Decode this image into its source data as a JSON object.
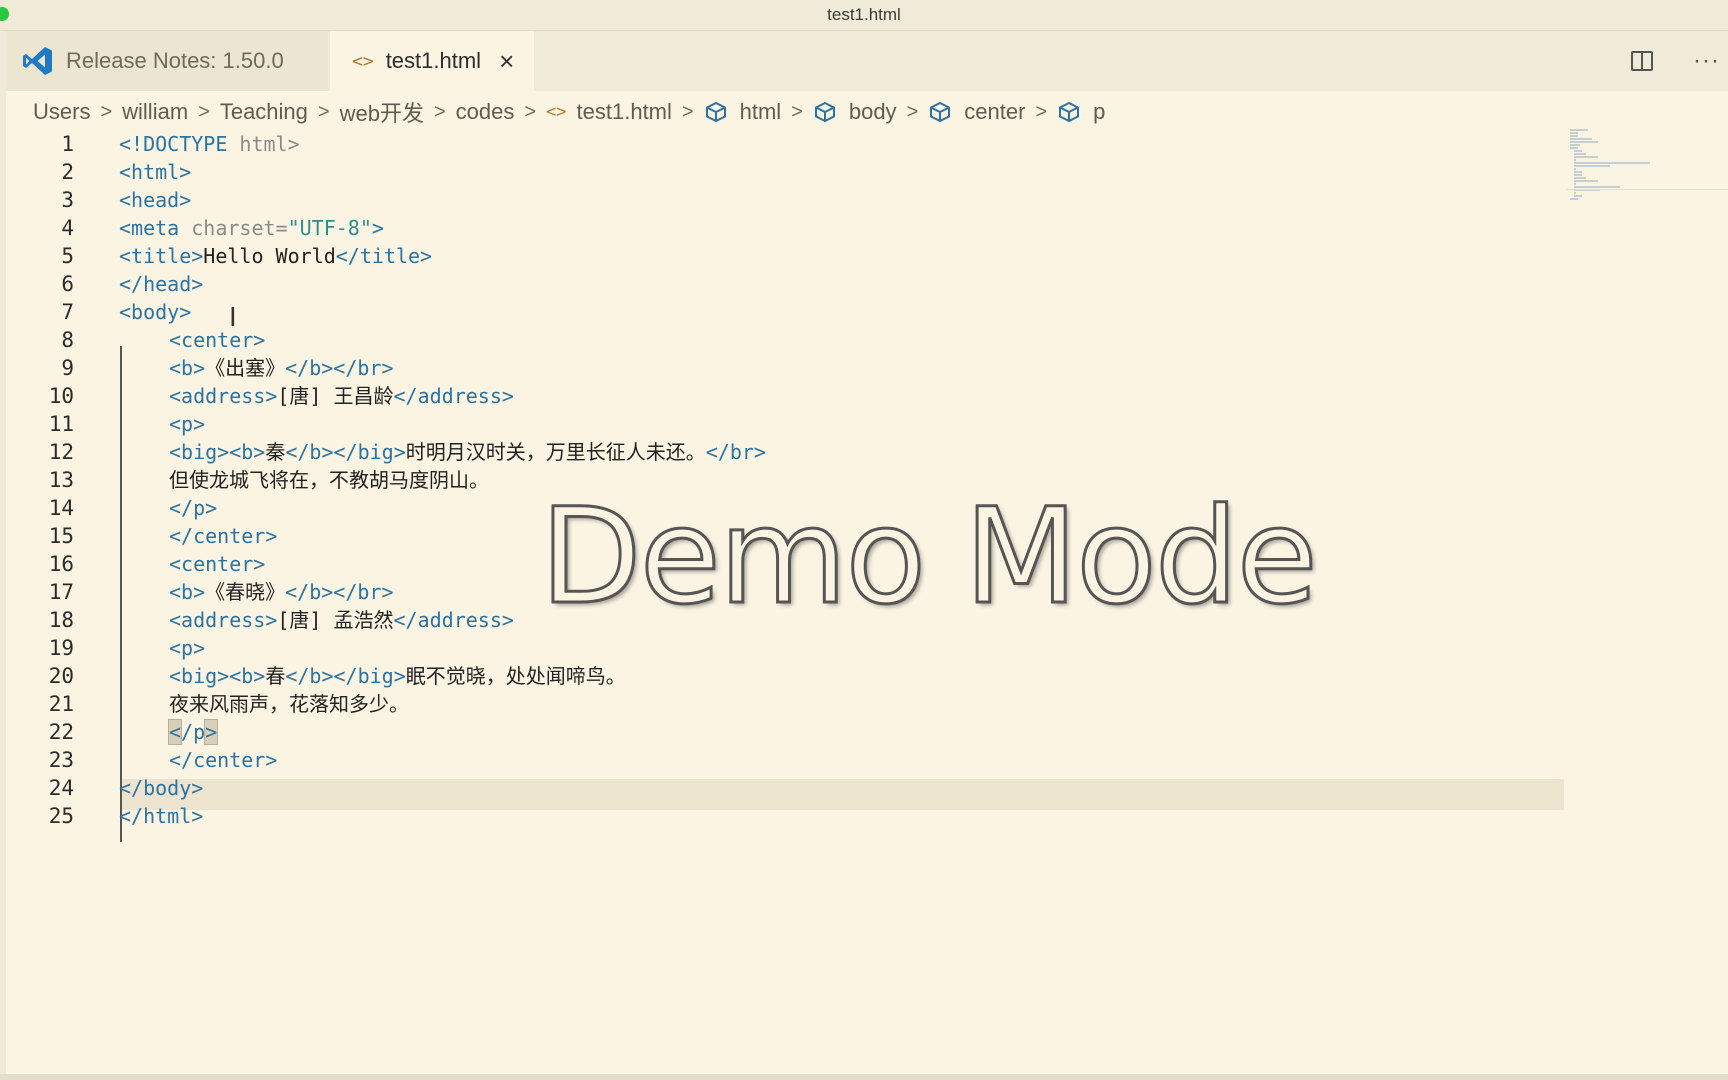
{
  "window": {
    "title": "test1.html"
  },
  "tabs": [
    {
      "label": "Release Notes: 1.50.0",
      "icon": "vscode-logo-icon",
      "active": false
    },
    {
      "label": "test1.html",
      "icon": "html-code-icon",
      "active": true,
      "close": "×"
    }
  ],
  "tab_actions": {
    "split": "split-editor-icon",
    "more": "···"
  },
  "breadcrumb": {
    "folders": [
      "Users",
      "william",
      "Teaching",
      "web开发",
      "codes"
    ],
    "file": "test1.html",
    "symbols": [
      "html",
      "body",
      "center",
      "p"
    ]
  },
  "editor": {
    "line_numbers": [
      "1",
      "2",
      "3",
      "4",
      "5",
      "6",
      "7",
      "8",
      "9",
      "10",
      "11",
      "12",
      "13",
      "14",
      "15",
      "16",
      "17",
      "18",
      "19",
      "20",
      "21",
      "22",
      "23",
      "24",
      "25"
    ],
    "lines": {
      "l1_doctype": "<!DOCTYPE",
      "l1_attr": " html>",
      "l2": "<html>",
      "l3": "<head>",
      "l4_tag": "<meta",
      "l4_attr": " charset=",
      "l4_val": "\"UTF-8\"",
      "l4_end": ">",
      "l5_open": "<title>",
      "l5_text": "Hello World",
      "l5_close": "</title>",
      "l6": "</head>",
      "l7": "<body>",
      "l8": "<center>",
      "l9_open": "<b>",
      "l9_text": "《出塞》",
      "l9_close": "</b></br>",
      "l10_open": "<address>",
      "l10_text": "[唐] 王昌龄",
      "l10_close": "</address>",
      "l11": "<p>",
      "l12_open": "<big><b>",
      "l12_char": "秦",
      "l12_mid": "</b></big>",
      "l12_text": "时明月汉时关，万里长征人未还。",
      "l12_close": "</br>",
      "l13_text": "但使龙城飞将在，不教胡马度阴山。",
      "l14": "</p>",
      "l15": "</center>",
      "l16": "<center>",
      "l17_open": "<b>",
      "l17_text": "《春晓》",
      "l17_close": "</b></br>",
      "l18_open": "<address>",
      "l18_text": "[唐] 孟浩然",
      "l18_close": "</address>",
      "l19": "<p>",
      "l20_open": "<big><b>",
      "l20_char": "春",
      "l20_mid": "</b></big>",
      "l20_text": "眠不觉晓，处处闻啼鸟。",
      "l21_text": "夜来风雨声，花落知多少。",
      "l22_lt": "<",
      "l22_mid": "/p",
      "l22_gt": ">",
      "l23": "</center>",
      "l24": "</body>",
      "l25": "</html>"
    }
  },
  "overlay": {
    "watermark": "Demo Mode"
  },
  "colors": {
    "background": "#fbf4e3",
    "tag": "#2b73a3",
    "string": "#2c8f8f",
    "attribute": "#8a8a8a"
  }
}
